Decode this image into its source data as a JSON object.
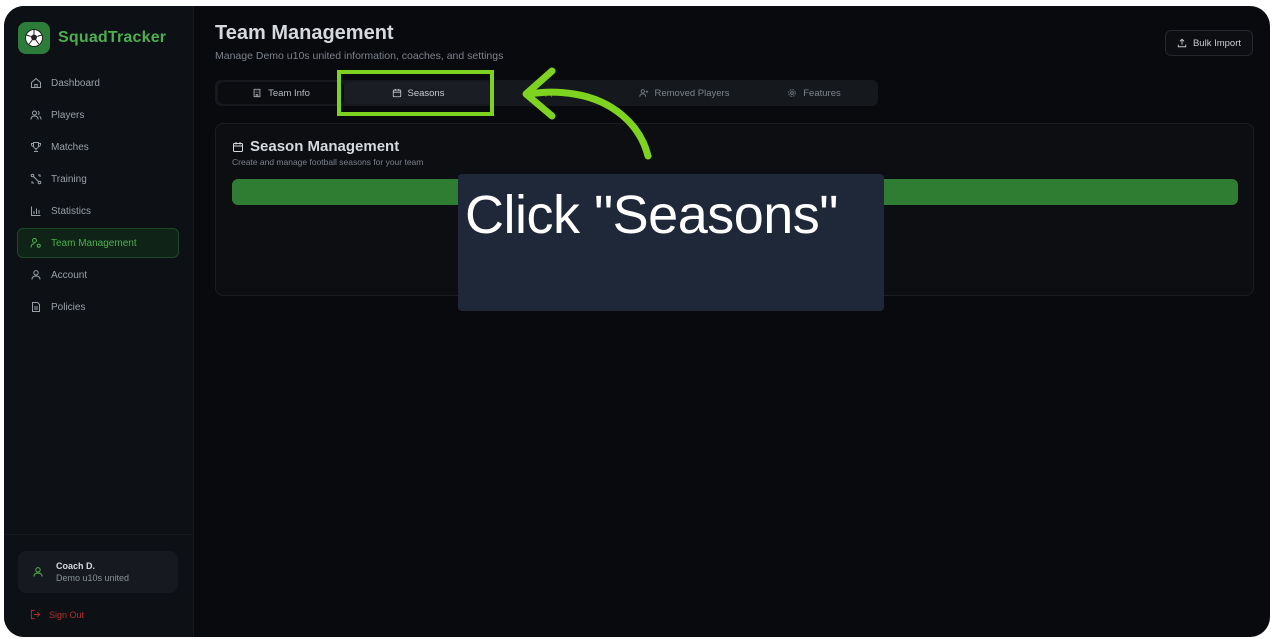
{
  "app": {
    "name": "SquadTracker"
  },
  "sidebar": {
    "items": [
      {
        "label": "Dashboard",
        "icon": "home-icon"
      },
      {
        "label": "Players",
        "icon": "users-icon"
      },
      {
        "label": "Matches",
        "icon": "trophy-icon"
      },
      {
        "label": "Training",
        "icon": "training-icon"
      },
      {
        "label": "Statistics",
        "icon": "bar-chart-icon"
      },
      {
        "label": "Team Management",
        "icon": "user-cog-icon",
        "active": true
      },
      {
        "label": "Account",
        "icon": "user-icon"
      },
      {
        "label": "Policies",
        "icon": "document-icon"
      }
    ],
    "user": {
      "name": "Coach D.",
      "team": "Demo u10s united"
    },
    "signout_label": "Sign Out"
  },
  "header": {
    "title": "Team Management",
    "subtitle": "Manage Demo u10s united information, coaches, and settings",
    "bulk_import_label": "Bulk Import"
  },
  "tabs": [
    {
      "label": "Team Info",
      "icon": "building-icon"
    },
    {
      "label": "Seasons",
      "icon": "calendar-icon",
      "active": true
    },
    {
      "label": "",
      "icon": "users-icon"
    },
    {
      "label": "Removed Players",
      "icon": "user-plus-icon"
    },
    {
      "label": "Features",
      "icon": "gear-icon"
    }
  ],
  "season_card": {
    "title": "Season Management",
    "subtitle": "Create and manage football seasons for your team"
  },
  "callout": {
    "text": "Click \"Seasons\""
  },
  "colors": {
    "accent": "#4caf50",
    "highlight": "#7ed321",
    "background": "#090a0d",
    "callout_bg": "#1e2838",
    "danger": "#b3312c"
  }
}
